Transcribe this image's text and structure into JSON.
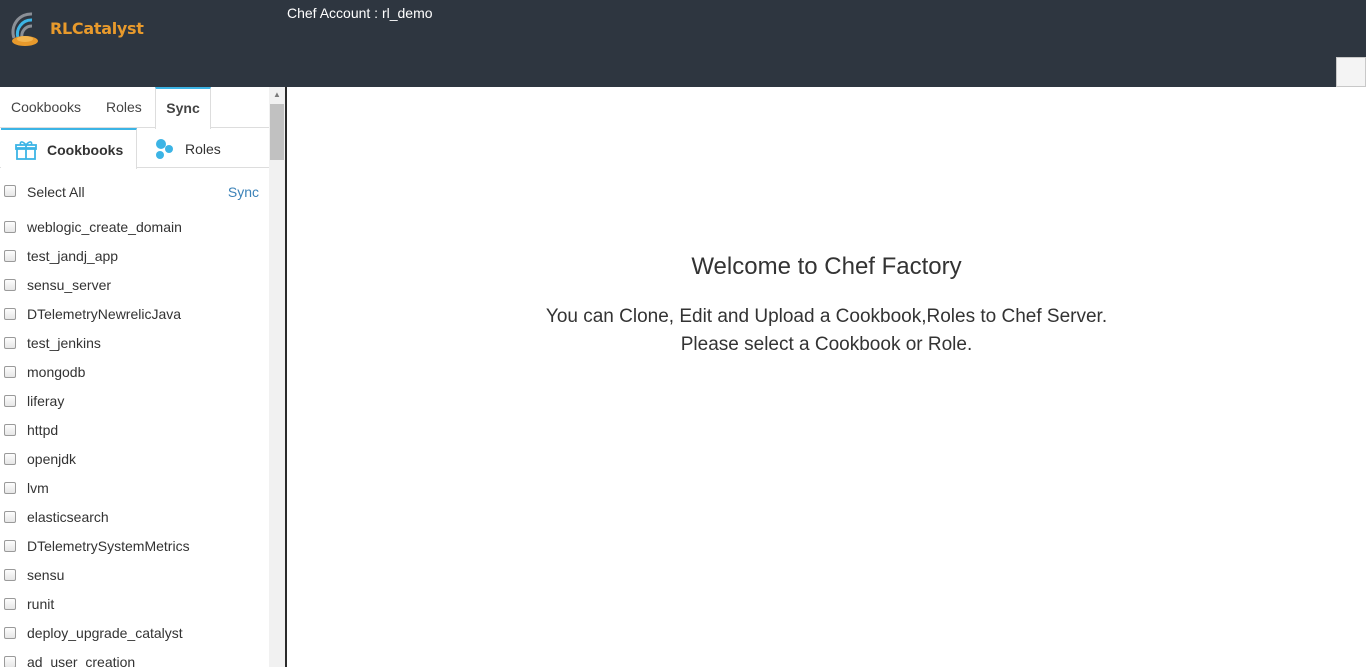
{
  "header": {
    "logo_text": "RLCatalyst",
    "account_text": "Chef Account : rl_demo"
  },
  "sidebar": {
    "tabs": [
      {
        "label": "Cookbooks",
        "active": false
      },
      {
        "label": "Roles",
        "active": false
      },
      {
        "label": "Sync",
        "active": true
      }
    ],
    "subtabs": [
      {
        "label": "Cookbooks",
        "icon": "cookbook-gift-icon",
        "active": true
      },
      {
        "label": "Roles",
        "icon": "roles-circles-icon",
        "active": false
      }
    ],
    "select_all_label": "Select All",
    "sync_label": "Sync",
    "items": [
      {
        "label": "weblogic_create_domain",
        "checked": false
      },
      {
        "label": "test_jandj_app",
        "checked": false
      },
      {
        "label": "sensu_server",
        "checked": false
      },
      {
        "label": "DTelemetryNewrelicJava",
        "checked": false
      },
      {
        "label": "test_jenkins",
        "checked": false
      },
      {
        "label": "mongodb",
        "checked": false
      },
      {
        "label": "liferay",
        "checked": false
      },
      {
        "label": "httpd",
        "checked": false
      },
      {
        "label": "openjdk",
        "checked": false
      },
      {
        "label": "lvm",
        "checked": false
      },
      {
        "label": "elasticsearch",
        "checked": false
      },
      {
        "label": "DTelemetrySystemMetrics",
        "checked": false
      },
      {
        "label": "sensu",
        "checked": false
      },
      {
        "label": "runit",
        "checked": false
      },
      {
        "label": "deploy_upgrade_catalyst",
        "checked": false
      },
      {
        "label": "ad_user_creation",
        "checked": false
      }
    ]
  },
  "main": {
    "welcome_title": "Welcome to Chef Factory",
    "desc_line1": "You can Clone, Edit and Upload a Cookbook,Roles to Chef Server.",
    "desc_line2": "Please select a Cookbook or Role."
  },
  "colors": {
    "header_bg": "#2e3640",
    "accent": "#3cb4e5",
    "link": "#3b82b8",
    "logo_orange": "#e89a2c"
  }
}
